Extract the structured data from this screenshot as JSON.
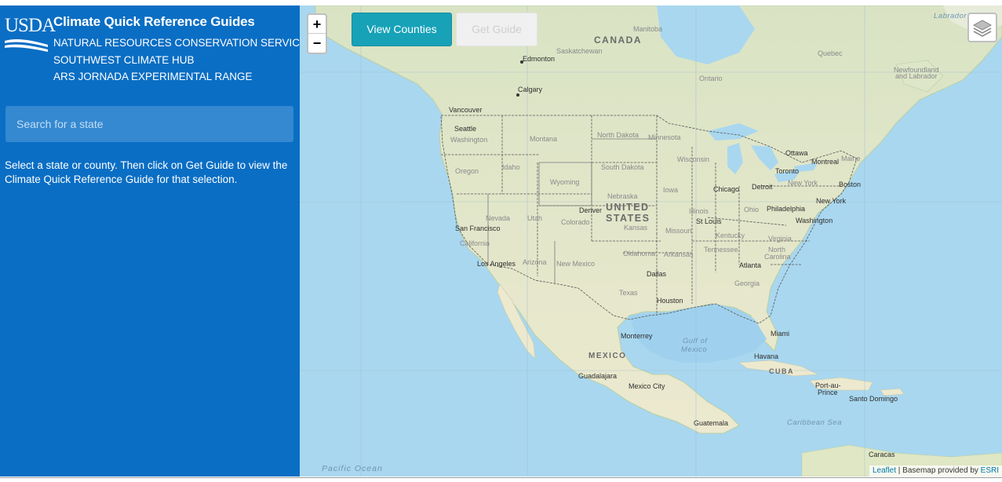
{
  "sidebar": {
    "logo_text": "USDA",
    "title": "Climate Quick Reference Guides",
    "org_lines": [
      "NATURAL RESOURCES CONSERVATION SERVICE",
      "SOUTHWEST CLIMATE HUB",
      "ARS JORNADA EXPERIMENTAL RANGE"
    ],
    "search_placeholder": "Search for a state",
    "instructions": "Select a state or county. Then click on Get Guide to view the Climate Quick Reference Guide for that selection."
  },
  "map": {
    "zoom_in": "+",
    "zoom_out": "−",
    "view_counties_label": "View Counties",
    "get_guide_label": "Get Guide",
    "layers_icon": "layers-icon",
    "attribution": {
      "leaflet": "Leaflet",
      "separator": " | Basemap provided by ",
      "esri": "ESRI"
    },
    "labels": {
      "canada": "CANADA",
      "united": "UNITED",
      "states": "STATES",
      "mexico": "MEXICO",
      "cuba": "CUBA",
      "labrador_sea": "Labrador Se",
      "gulf_of": "Gulf of",
      "mexico_water": "Mexico",
      "caribbean_sea": "Caribbean Sea",
      "pacific_ocean": "Pacific Ocean",
      "manitoba": "Manitoba",
      "saskatchewan": "Saskatchewan",
      "quebec": "Quebec",
      "ontario": "Ontario",
      "newfoundland": "Newfoundland",
      "and_labrador": "and Labrador",
      "edmonton": "Edmonton",
      "calgary": "Calgary",
      "vancouver": "Vancouver",
      "seattle": "Seattle",
      "washington": "Washington",
      "montana": "Montana",
      "north_dakota": "North Dakota",
      "minnesota": "Minnesota",
      "oregon": "Oregon",
      "idaho": "Idaho",
      "south_dakota": "South Dakota",
      "wisconsin": "Wisconsin",
      "wyoming": "Wyoming",
      "iowa": "Iowa",
      "nebraska": "Nebraska",
      "chicago": "Chicago",
      "detroit": "Detroit",
      "ottawa": "Ottawa",
      "montreal": "Montreal",
      "maine": "Maine",
      "toronto": "Toronto",
      "new_york_state": "New York",
      "boston": "Boston",
      "new_york_city": "New York",
      "philadelphia": "Philadelphia",
      "washington_dc": "Washington",
      "nevada": "Nevada",
      "utah": "Utah",
      "denver": "Denver",
      "colorado": "Colorado",
      "kansas": "Kansas",
      "illinois": "Illinois",
      "ohio": "Ohio",
      "san_francisco": "San Francisco",
      "california": "California",
      "st_louis": "St Louis",
      "missouri": "Missouri",
      "kentucky": "Kentucky",
      "virginia": "Virginia",
      "los_angeles": "Los Angeles",
      "arizona": "Arizona",
      "new_mexico": "New Mexico",
      "oklahoma": "Oklahoma",
      "arkansas": "Arkansas",
      "tennessee": "Tennessee",
      "north": "North",
      "carolina": "Carolina",
      "atlanta": "Atlanta",
      "dallas": "Dallas",
      "georgia": "Georgia",
      "texas": "Texas",
      "houston": "Houston",
      "monterrey": "Monterrey",
      "miami": "Miami",
      "havana": "Havana",
      "guadalajara": "Guadalajara",
      "mexico_city": "Mexico City",
      "port_au": "Port-au-",
      "prince": "Prince",
      "santo_domingo": "Santo Domingo",
      "guatemala": "Guatemala",
      "caracas": "Caracas"
    }
  }
}
